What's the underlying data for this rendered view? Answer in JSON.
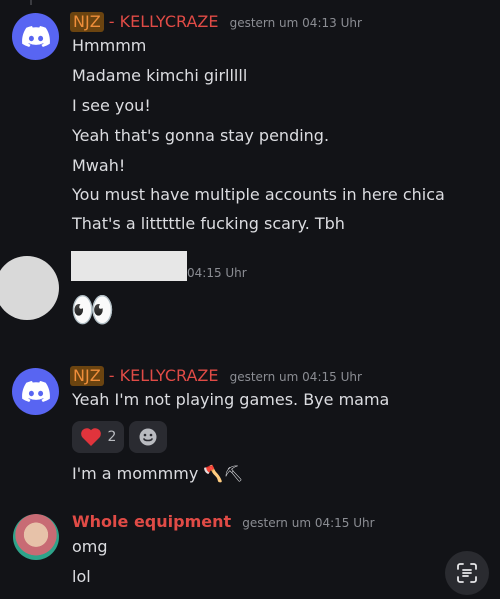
{
  "messages": [
    {
      "tag": "NJZ",
      "separator": "-",
      "username": "KELLYCRAZE",
      "timestamp": "gestern um 04:13 Uhr",
      "lines": [
        "Hmmmm",
        "Madame kimchi girlllll",
        "I see you!",
        "Yeah that's gonna stay pending.",
        "Mwah!",
        "You must have multiple accounts in here chica",
        "That's a litttttle fucking scary. Tbh"
      ]
    },
    {
      "timestamp": "04:15 Uhr",
      "emoji": "👀"
    },
    {
      "tag": "NJZ",
      "separator": "-",
      "username": "KELLYCRAZE",
      "timestamp": "gestern um 04:15 Uhr",
      "lines": [
        "Yeah I'm not playing games. Bye mama",
        "I'm a mommmy 🪓⛏"
      ],
      "reactions": [
        {
          "emoji": "heart",
          "count": "2"
        }
      ]
    },
    {
      "username": "Whole equipment",
      "timestamp": "gestern um 04:15 Uhr",
      "lines": [
        "omg",
        "lol"
      ]
    }
  ],
  "colors": {
    "background": "#121317",
    "discord_blurple": "#5865f2",
    "username_red": "#e04b46",
    "tag_bg": "#6b4410",
    "tag_fg": "#ef8e3a",
    "heart": "#e0343c"
  },
  "icons": [
    "discord-logo-icon",
    "heart-icon",
    "add-reaction-icon",
    "text-recognition-icon"
  ]
}
